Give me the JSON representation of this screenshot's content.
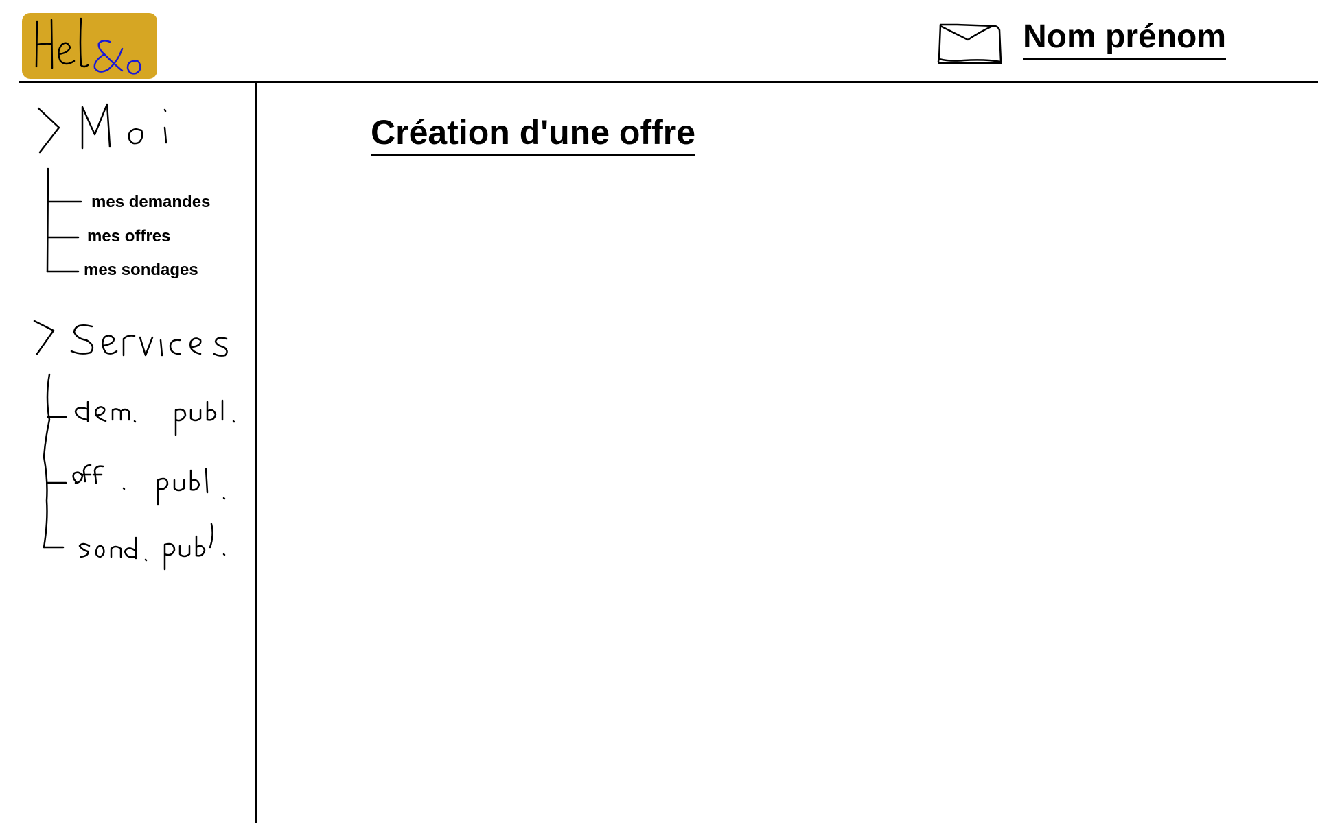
{
  "header": {
    "logo_text": "Hel&o",
    "mail_icon": "envelope-icon",
    "user_name": "Nom prénom"
  },
  "sidebar": {
    "moi": {
      "label": "Moi",
      "items": [
        {
          "label": "mes demandes"
        },
        {
          "label": "mes offres"
        },
        {
          "label": "mes sondages"
        }
      ]
    },
    "services": {
      "label": "Services",
      "items": [
        {
          "label": "dem. publ."
        },
        {
          "label": "off. publ."
        },
        {
          "label": "sond. publ."
        }
      ]
    }
  },
  "main": {
    "title": "Création d'une offre"
  },
  "colors": {
    "logo_background": "#d6a623",
    "logo_accent": "#1a1ad6",
    "ink": "#000000"
  }
}
